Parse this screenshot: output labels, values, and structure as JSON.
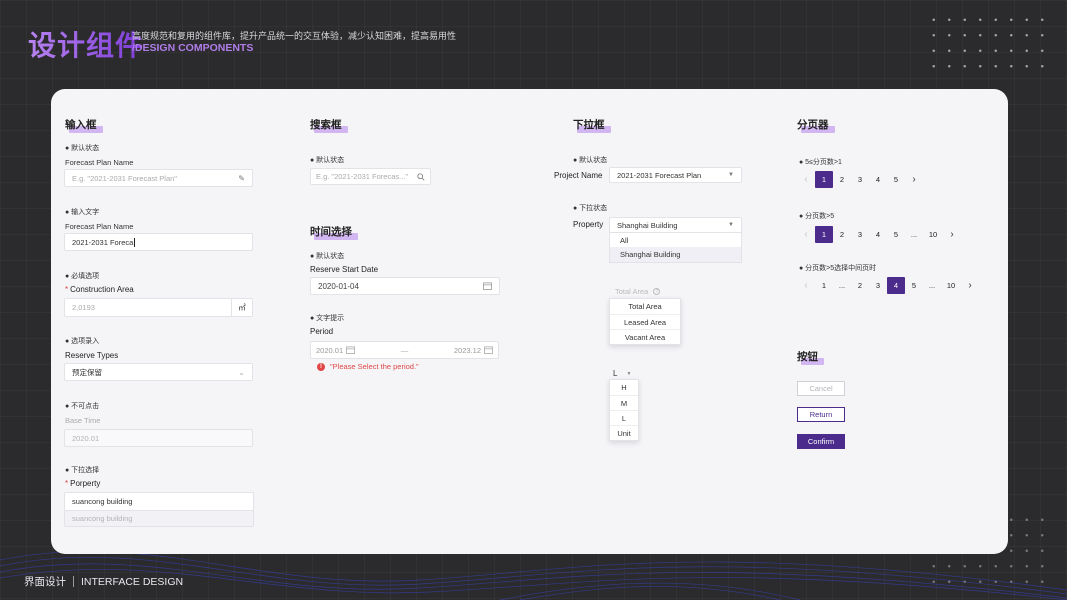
{
  "header": {
    "title": "设计组件",
    "description": "高度规范和复用的组件库，提升产品统一的交互体验，减少认知困难，提高易用性",
    "subtitle": "/DESIGN COMPONENTS"
  },
  "footer": {
    "left": "界面设计",
    "right": "INTERFACE DESIGN"
  },
  "input_section": {
    "title": "输入框",
    "default": {
      "bullet": "● 默认状态",
      "label": "Forecast Plan Name",
      "placeholder": "E.g. \"2021-2031 Forecast Plan\"",
      "icon": "pencil-icon"
    },
    "text": {
      "bullet": "● 输入文字",
      "label": "Forecast Plan Name",
      "value": "2021-2031 Foreca"
    },
    "required": {
      "bullet": "● 必填选项",
      "label": "Construction Area",
      "value": "2,0193",
      "unit": "㎡"
    },
    "optional": {
      "bullet": "● 选项录入",
      "label": "Reserve Types",
      "value": "预定保留"
    },
    "disabled": {
      "bullet": "● 不可点击",
      "label": "Base Time",
      "value": "2020.01"
    },
    "dropdown": {
      "bullet": "● 下拉选择",
      "label": "Porperty",
      "value": "suancong building",
      "option": "suancong building"
    }
  },
  "search_section": {
    "title": "搜索框",
    "bullet": "● 默认状态",
    "placeholder": "E.g. \"2021-2031 Forecas...\"",
    "icon": "search-icon"
  },
  "time_section": {
    "title": "时间选择",
    "default": {
      "bullet": "● 默认状态",
      "label": "Reserve Start Date",
      "value": "2020-01-04",
      "icon": "calendar-icon"
    },
    "hint": {
      "bullet": "● 文字提示",
      "label": "Period",
      "start": "2020.01",
      "end": "2023.12",
      "error": "\"Please Select the period.\""
    }
  },
  "dropdown_section": {
    "title": "下拉框",
    "default": {
      "bullet": "● 默认状态",
      "label": "Project Name",
      "value": "2021-2031 Forecast Plan"
    },
    "open": {
      "bullet": "● 下拉状态",
      "label": "Property",
      "value": "Shanghai Building",
      "options": [
        "All",
        "Shanghai Building"
      ]
    },
    "area": {
      "label": "Total Area",
      "icon": "help-icon",
      "options": [
        "Total Area",
        "Leased Area",
        "Vacant Area"
      ]
    },
    "level": {
      "value": "L",
      "options": [
        "H",
        "M",
        "L",
        "Unit"
      ]
    }
  },
  "pagination_section": {
    "title": "分页器",
    "row1": {
      "bullet": "● 5≤分页数>1",
      "pages": [
        "1",
        "2",
        "3",
        "4",
        "5"
      ],
      "active": "1"
    },
    "row2": {
      "bullet": "● 分页数>5",
      "pages": [
        "1",
        "2",
        "3",
        "4",
        "5",
        "...",
        "10"
      ],
      "active": "1"
    },
    "row3": {
      "bullet": "● 分页数>5选择中间页时",
      "pages": [
        "1",
        "...",
        "2",
        "3",
        "4",
        "5",
        "...",
        "10"
      ],
      "active": "4"
    }
  },
  "button_section": {
    "title": "按钮",
    "cancel": "Cancel",
    "return": "Return",
    "confirm": "Confirm"
  },
  "colors": {
    "accent": "#4b2b8c",
    "highlight": "#d2b6f1",
    "error": "#e04646"
  }
}
